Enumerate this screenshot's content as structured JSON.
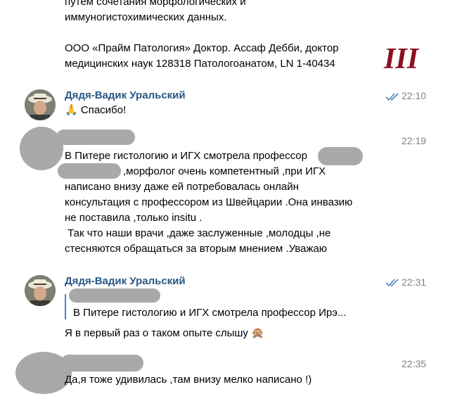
{
  "top_message": {
    "line1": "путем сочетания морфологических и",
    "line2": "иммуногистохимических данных.",
    "line3": "ООО «Прайм Патология» Доктор. Ассаф Дебби, доктор",
    "line4": "медицинских наук 128318 Патологоанатом, LN 1-40434",
    "roman": "III"
  },
  "messages": [
    {
      "author": "Дядя-Вадик Уральский",
      "time": "22:10",
      "emoji": "🙏",
      "text": "Спасибо!"
    },
    {
      "time": "22:19",
      "lines": [
        "В Питере гистологию и ИГХ смотрела профессор",
        ",морфолог очень компетентный ,при ИГХ",
        "написано внизу даже ей потребовалась онлайн",
        "консультация с профессором из Швейцарии .Она инвазию",
        "не поставила ,только insitu .",
        " Так что наши врачи ,даже заслуженные ,молодцы ,не",
        "стесняются обращаться за вторым мнением .Уважаю"
      ]
    },
    {
      "author": "Дядя-Вадик Уральский",
      "time": "22:31",
      "quote": "В Питере гистологию и ИГХ смотрела профессор Ирэ...",
      "text": "Я в первый раз о таком опыте слышу",
      "emoji": "🙊"
    },
    {
      "time": "22:35",
      "text": "Да,я тоже удивилась ,там внизу мелко написано !)"
    }
  ],
  "colors": {
    "name": "#2a5885",
    "time": "#828282",
    "check": "#5181b8",
    "redaction": "#a9a9a9",
    "roman": "#8b1020"
  }
}
